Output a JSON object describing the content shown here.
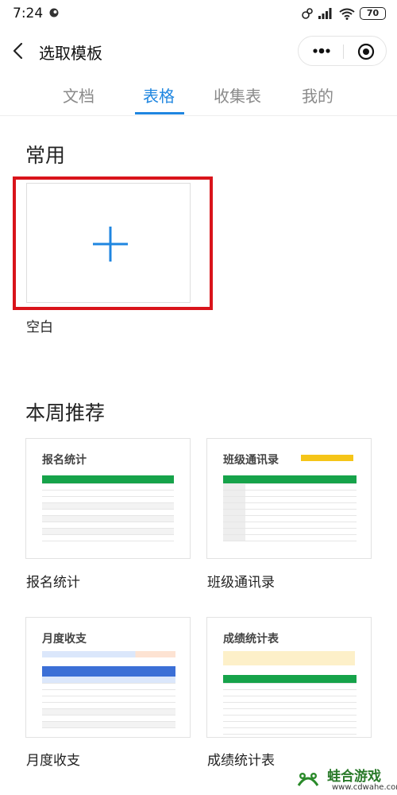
{
  "status": {
    "time": "7:24",
    "battery": "70"
  },
  "header": {
    "title": "选取模板"
  },
  "tabs": [
    {
      "label": "文档"
    },
    {
      "label": "表格"
    },
    {
      "label": "收集表"
    },
    {
      "label": "我的"
    }
  ],
  "sections": {
    "common": {
      "title": "常用",
      "blank_label": "空白"
    },
    "weekly": {
      "title": "本周推荐",
      "templates": [
        {
          "label": "报名统计",
          "thumb_title": "报名统计"
        },
        {
          "label": "班级通讯录",
          "thumb_title": "班级通讯录"
        },
        {
          "label": "月度收支",
          "thumb_title": "月度收支"
        },
        {
          "label": "成绩统计表",
          "thumb_title": "成绩统计表"
        }
      ]
    }
  },
  "watermark": {
    "name": "蛙合游戏",
    "url": "www.cdwahe.com"
  },
  "colors": {
    "accent": "#1f86e0",
    "highlight": "#d9141b",
    "table_header": "#16a34a"
  }
}
